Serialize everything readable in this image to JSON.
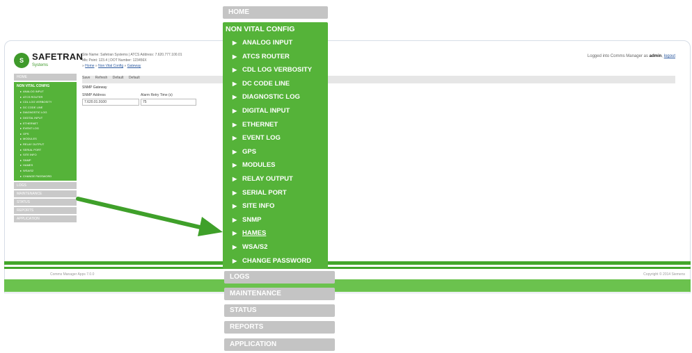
{
  "background_screenshot": {
    "logo_text": "SAFETRAN",
    "logo_sub": "Systems",
    "site_info_line1": "Site Name: Safetran Systems | ATCS Address: 7.620.777.100.01",
    "site_info_line2": "Mtc Point: 123.4           | DOT Number: 123456X",
    "breadcrumb_home": "Home",
    "breadcrumb_mid": "Non Vital Config",
    "breadcrumb_current": "Gateway",
    "login_prefix": "Logged into Comms Manager as",
    "login_user": "admin",
    "login_logout": "logout",
    "toolbar": [
      "Save",
      "Refresh",
      "Default",
      "Default"
    ],
    "section_title": "SNMP Gateway",
    "col1_header": "SNMP Address",
    "col2_header": "Alarm Retry Time (s)",
    "col1_value": "7.620.01.9100",
    "col2_value": "75",
    "nav_home": "HOME",
    "nav_title": "NON VITAL CONFIG",
    "nav_items": [
      "ANALOG INPUT",
      "ATCS ROUTER",
      "CDL LOG VERBOSITY",
      "DC CODE LINE",
      "DIAGNOSTIC LOG",
      "DIGITAL INPUT",
      "ETHERNET",
      "EVENT LOG",
      "GPS",
      "MODULES",
      "RELAY OUTPUT",
      "SERIAL PORT",
      "SITE INFO",
      "SNMP",
      "HAMES",
      "WSA/S2",
      "CHANGE PASSWORD"
    ],
    "nav_bottom": [
      "LOGS",
      "MAINTENANCE",
      "STATUS",
      "REPORTS",
      "APPLICATION"
    ],
    "footer_left": "Comms Manager Apps 7.0.0",
    "footer_right": "Copyright © 2014 Siemens"
  },
  "zoom_menu": {
    "home": "HOME",
    "title": "NON VITAL CONFIG",
    "items": [
      {
        "label": "ANALOG INPUT"
      },
      {
        "label": "ATCS ROUTER"
      },
      {
        "label": "CDL LOG VERBOSITY"
      },
      {
        "label": "DC CODE LINE"
      },
      {
        "label": "DIAGNOSTIC LOG"
      },
      {
        "label": "DIGITAL INPUT"
      },
      {
        "label": "ETHERNET"
      },
      {
        "label": "EVENT LOG"
      },
      {
        "label": "GPS"
      },
      {
        "label": "MODULES"
      },
      {
        "label": "RELAY OUTPUT"
      },
      {
        "label": "SERIAL PORT"
      },
      {
        "label": "SITE INFO"
      },
      {
        "label": "SNMP"
      },
      {
        "label": "HAMES"
      },
      {
        "label": "WSA/S2"
      },
      {
        "label": "CHANGE PASSWORD"
      }
    ],
    "active_item": "HAMES",
    "bottom": [
      "LOGS",
      "MAINTENANCE",
      "STATUS",
      "REPORTS",
      "APPLICATION"
    ]
  },
  "colors": {
    "menu_green": "#55b339",
    "menu_gray": "#c4c4c4",
    "arrow_green": "#3fa02a"
  },
  "icons": {
    "menu_item_marker": "triangle-right-icon",
    "arrow": "pointer-arrow-icon"
  }
}
